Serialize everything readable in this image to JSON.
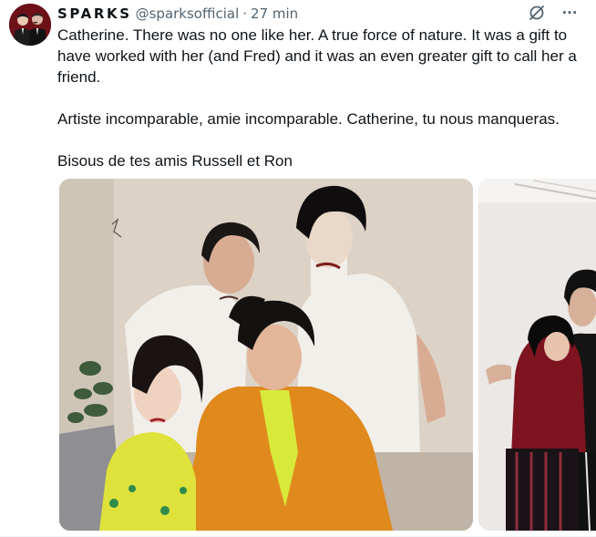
{
  "tweet": {
    "author": {
      "display_name": "SPARKS",
      "handle": "@sparksofficial"
    },
    "separator": "·",
    "time": "27 min",
    "icons": {
      "grok": "grok-icon",
      "more": "more-icon",
      "more_symbol": "···"
    },
    "paragraphs": [
      "Catherine. There was no one like her. A true force of nature. It was a gift to have worked with her (and Fred) and it was an even greater gift to call her a friend.",
      "Artiste incomparable, amie incomparable. Catherine, tu nous manqueras.",
      "Bisous de tes amis Russell et Ron"
    ]
  },
  "colors": {
    "text": "#0f1419",
    "secondary": "#536471",
    "divider": "#eff3f4"
  }
}
